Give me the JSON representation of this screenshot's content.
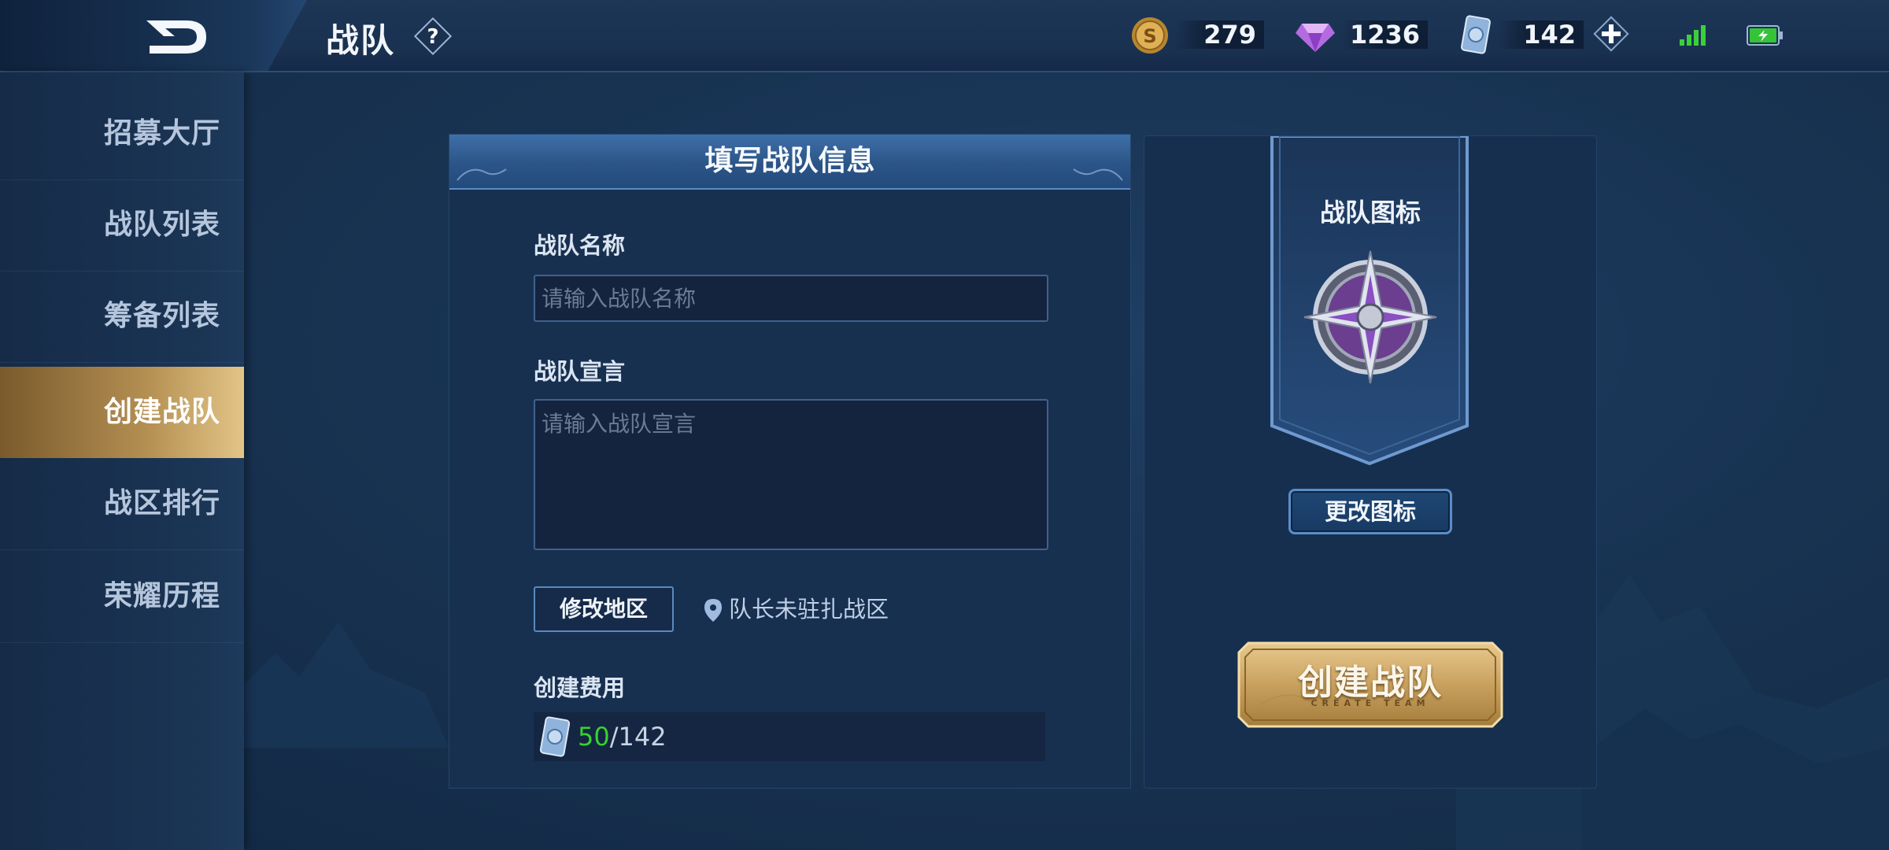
{
  "header": {
    "title": "战队",
    "help_label": "?",
    "gold": "279",
    "diamonds": "1236",
    "coupons": "142",
    "add_label": "+"
  },
  "sidebar": {
    "items": [
      {
        "label": "招募大厅"
      },
      {
        "label": "战队列表"
      },
      {
        "label": "筹备列表"
      },
      {
        "label": "创建战队",
        "active": true
      },
      {
        "label": "战区排行"
      },
      {
        "label": "荣耀历程"
      }
    ]
  },
  "form": {
    "title": "填写战队信息",
    "name_label": "战队名称",
    "name_placeholder": "请输入战队名称",
    "name_value": "",
    "declaration_label": "战队宣言",
    "declaration_placeholder": "请输入战队宣言",
    "declaration_value": "",
    "modify_region_label": "修改地区",
    "region_status": "队长未驻扎战区",
    "cost_label": "创建费用",
    "cost_current": "50",
    "cost_total": "142",
    "cost_separator": "/"
  },
  "icon_panel": {
    "title": "战队图标",
    "change_icon_label": "更改图标",
    "create_button_label": "创建战队",
    "create_button_sub": "CREATE TEAM"
  },
  "icons": {
    "back": "back-arrow-icon",
    "gold": "gold-coin-icon",
    "diamond": "diamond-gem-icon",
    "coupon": "coupon-card-icon",
    "signal": "signal-icon",
    "battery": "battery-icon",
    "location": "location-pin-icon"
  },
  "colors": {
    "accent_gold": "#c9a15f",
    "cost_affordable": "#38d12f",
    "signal": "#3ccf3c",
    "battery": "#35c435"
  }
}
